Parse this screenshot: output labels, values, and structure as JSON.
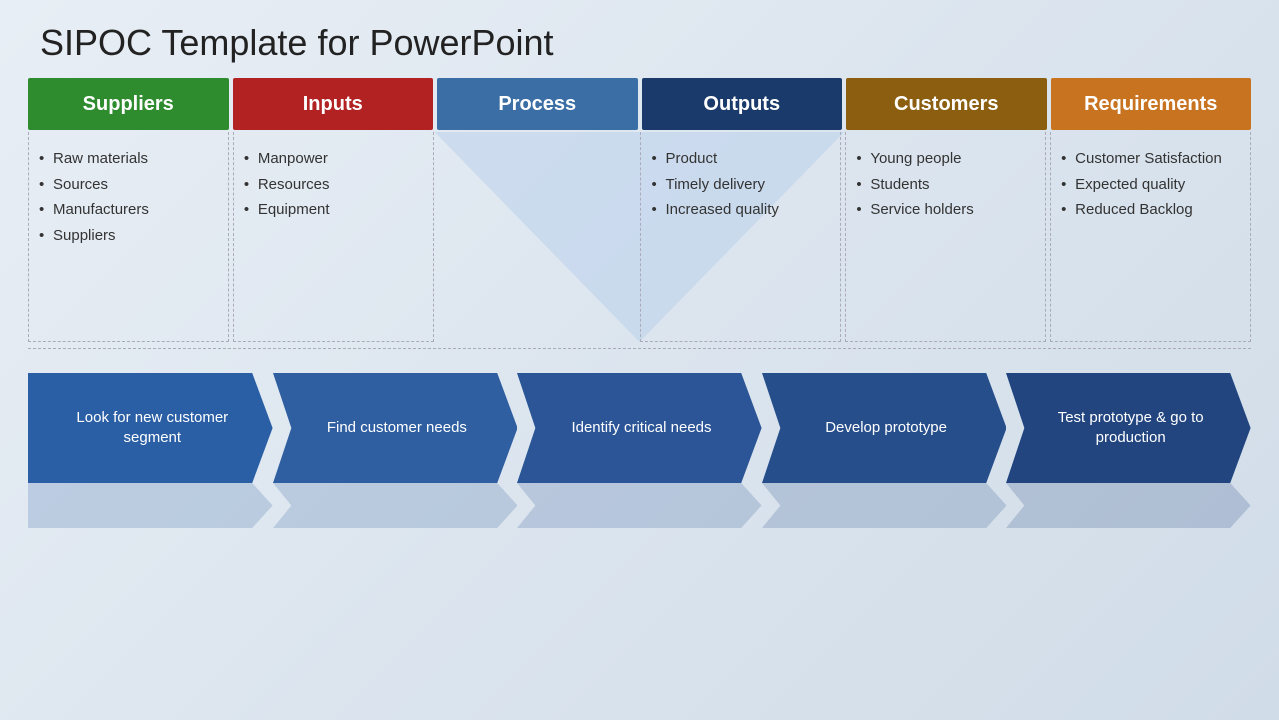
{
  "title": "SIPOC Template for PowerPoint",
  "sipoc": {
    "headers": [
      {
        "id": "suppliers",
        "label": "Suppliers",
        "colorClass": "header-suppliers"
      },
      {
        "id": "inputs",
        "label": "Inputs",
        "colorClass": "header-inputs"
      },
      {
        "id": "process",
        "label": "Process",
        "colorClass": "header-process"
      },
      {
        "id": "outputs",
        "label": "Outputs",
        "colorClass": "header-outputs"
      },
      {
        "id": "customers",
        "label": "Customers",
        "colorClass": "header-customers"
      },
      {
        "id": "requirements",
        "label": "Requirements",
        "colorClass": "header-requirements"
      }
    ],
    "body": [
      {
        "id": "suppliers-body",
        "items": [
          "Raw materials",
          "Sources",
          "Manufacturers",
          "Suppliers"
        ]
      },
      {
        "id": "inputs-body",
        "items": [
          "Manpower",
          "Resources",
          "Equipment"
        ]
      },
      {
        "id": "process-body",
        "items": []
      },
      {
        "id": "outputs-body",
        "items": [
          "Product",
          "Timely delivery",
          "Increased quality"
        ]
      },
      {
        "id": "customers-body",
        "items": [
          "Young people",
          "Students",
          "Service holders"
        ]
      },
      {
        "id": "requirements-body",
        "items": [
          "Customer Satisfaction",
          "Expected quality",
          "Reduced Backlog"
        ]
      }
    ]
  },
  "steps": [
    {
      "id": "step1",
      "label": "Look for new customer segment",
      "color": "#2a5fa5"
    },
    {
      "id": "step2",
      "label": "Find customer needs",
      "color": "#2f5fa0"
    },
    {
      "id": "step3",
      "label": "Identify critical needs",
      "color": "#2b5596"
    },
    {
      "id": "step4",
      "label": "Develop prototype",
      "color": "#264e8a"
    },
    {
      "id": "step5",
      "label": "Test prototype & go to production",
      "color": "#224580"
    }
  ]
}
